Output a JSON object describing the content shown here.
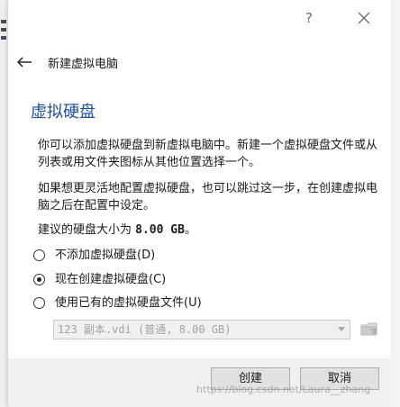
{
  "window": {
    "help_label": "?",
    "close_icon": "close-icon"
  },
  "header": {
    "back_icon": "arrow-left-icon",
    "title": "新建虚拟电脑"
  },
  "section": {
    "title": "虚拟硬盘"
  },
  "paragraphs": {
    "p1": "你可以添加虚拟硬盘到新虚拟电脑中。新建一个虚拟硬盘文件或从列表或用文件夹图标从其他位置选择一个。",
    "p2": "如果想更灵活地配置虚拟硬盘，也可以跳过这一步，在创建虚拟电脑之后在配置中设定。",
    "p3_prefix": "建议的硬盘大小为 ",
    "p3_size": "8.00 GB",
    "p3_suffix": "。"
  },
  "options": [
    {
      "label": "不添加虚拟硬盘(D)",
      "checked": false
    },
    {
      "label": "现在创建虚拟硬盘(C)",
      "checked": true
    },
    {
      "label": "使用已有的虚拟硬盘文件(U)",
      "checked": false
    }
  ],
  "disk_select": {
    "value": "123 副本.vdi (普通, 8.00 GB)",
    "enabled": false
  },
  "folder_button": {
    "icon": "folder-icon"
  },
  "buttons": {
    "create": "创建",
    "cancel": "取消"
  },
  "watermark": "https://blog.csdn.net/Laura__zhang"
}
